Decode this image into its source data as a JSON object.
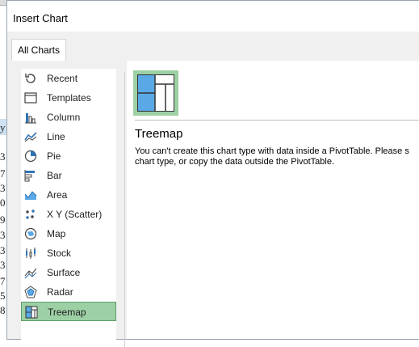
{
  "dialog": {
    "title": "Insert Chart",
    "tab_label": "All Charts"
  },
  "chart_types": [
    {
      "label": "Recent",
      "icon": "recent-icon"
    },
    {
      "label": "Templates",
      "icon": "templates-icon"
    },
    {
      "label": "Column",
      "icon": "column-chart-icon"
    },
    {
      "label": "Line",
      "icon": "line-chart-icon"
    },
    {
      "label": "Pie",
      "icon": "pie-chart-icon"
    },
    {
      "label": "Bar",
      "icon": "bar-chart-icon"
    },
    {
      "label": "Area",
      "icon": "area-chart-icon"
    },
    {
      "label": "X Y (Scatter)",
      "icon": "scatter-chart-icon"
    },
    {
      "label": "Map",
      "icon": "map-chart-icon"
    },
    {
      "label": "Stock",
      "icon": "stock-chart-icon"
    },
    {
      "label": "Surface",
      "icon": "surface-chart-icon"
    },
    {
      "label": "Radar",
      "icon": "radar-chart-icon"
    },
    {
      "label": "Treemap",
      "icon": "treemap-chart-icon",
      "selected": true
    }
  ],
  "detail": {
    "name": "Treemap",
    "message_line1": "You can't create this chart type with data inside a PivotTable. Please s",
    "message_line2": "chart type, or copy the data outside the PivotTable."
  },
  "background": {
    "cells": [
      "y",
      "3",
      "7",
      "3",
      "0",
      "9",
      "3",
      "3",
      "3",
      "7",
      "5",
      "8"
    ]
  },
  "colors": {
    "selected_bg": "#9dd0a5",
    "selected_border": "#5c9e69",
    "icon_blue": "#2e75b6",
    "treemap_fill": "#5aa9e6"
  }
}
